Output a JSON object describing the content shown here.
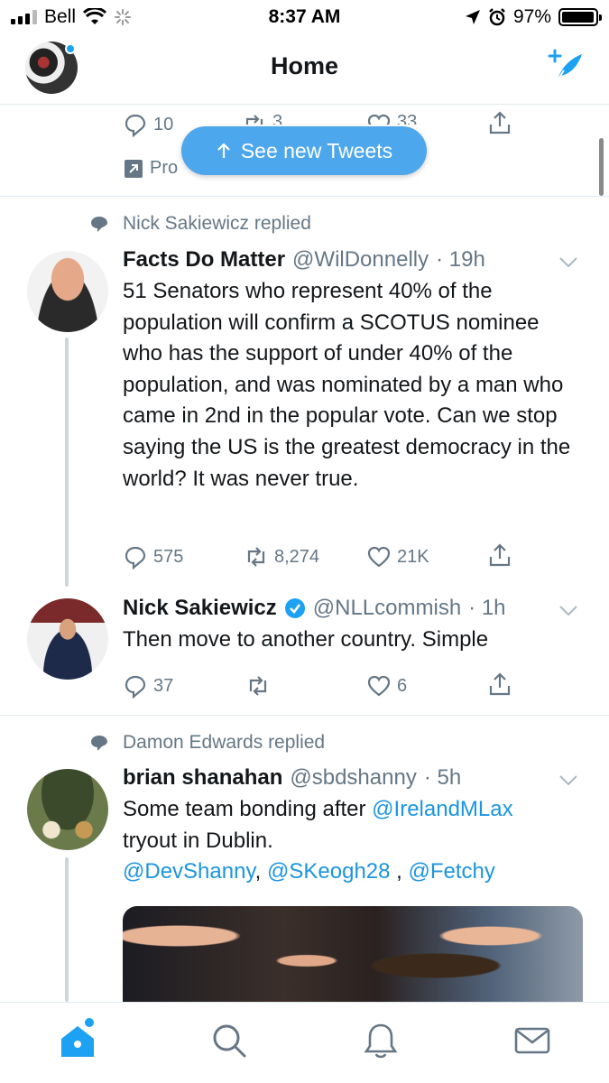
{
  "status_bar": {
    "carrier": "Bell",
    "time": "8:37 AM",
    "battery": "97%",
    "battery_level": 0.97
  },
  "header": {
    "title": "Home"
  },
  "colors": {
    "accent": "#1da1f2",
    "link": "#1b95e0",
    "secondary_text": "#657786",
    "divider": "#e1e8ed"
  },
  "new_tweets_pill": {
    "label": "See new Tweets",
    "icon": "arrow-up-icon"
  },
  "partial_tweet": {
    "reply_count": "10",
    "retweet_count": "3",
    "like_count": "33",
    "promoted_label": "Pro"
  },
  "thread_1": {
    "social_context": "Nick Sakiewicz replied",
    "tweets": [
      {
        "name": "Facts Do Matter",
        "handle": "@WilDonnelly",
        "time": "· 19h",
        "text": "51 Senators who represent 40% of the population will confirm a SCOTUS nominee who has the support of under 40% of the population, and was nominated by a man who came in 2nd in the popular vote. Can we stop saying the US is the greatest democracy in the world? It was never true.",
        "replies": "575",
        "retweets": "8,274",
        "likes": "21K"
      },
      {
        "name": "Nick Sakiewicz",
        "handle": "@NLLcommish",
        "time": "· 1h",
        "verified": true,
        "text": "Then move to another country. Simple",
        "replies": "37",
        "retweets": "",
        "likes": "6"
      }
    ]
  },
  "thread_2": {
    "social_context": "Damon Edwards replied",
    "tweet": {
      "name": "brian shanahan",
      "handle": "@sbdshanny",
      "time": "· 5h",
      "text_before": "Some team bonding after ",
      "mention_1": "@IrelandMLax",
      "text_after": "tryout in Dublin.",
      "mention_2": "@DevShanny",
      "comma_1": ", ",
      "mention_3": "@SKeogh28",
      "comma_2": " , ",
      "mention_4": "@Fetchy"
    }
  },
  "tab_bar": {
    "tabs": [
      "home-icon",
      "search-icon",
      "notifications-icon",
      "messages-icon"
    ]
  }
}
